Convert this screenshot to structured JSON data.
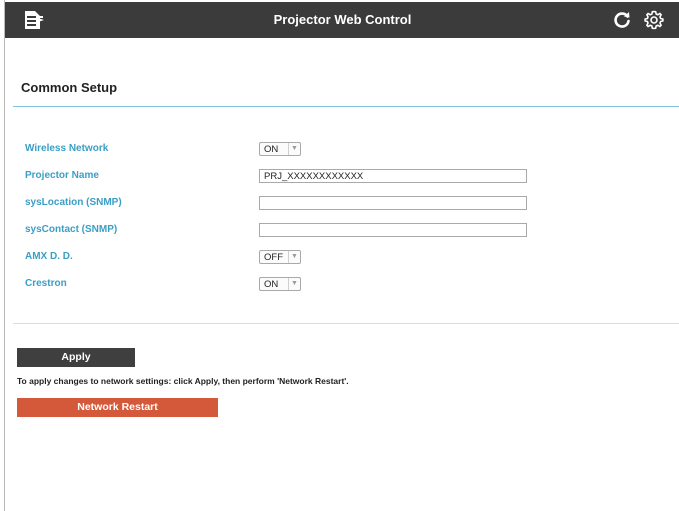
{
  "header": {
    "title": "Projector Web Control",
    "icons": {
      "menu": "menu-icon",
      "refresh": "refresh-icon",
      "settings": "gear-icon"
    },
    "background_color": "#3b3b3b"
  },
  "section": {
    "title": "Common Setup"
  },
  "settings": {
    "wireless_network": {
      "label": "Wireless Network",
      "value": "ON"
    },
    "projector_name": {
      "label": "Projector Name",
      "value": "PRJ_XXXXXXXXXXXX"
    },
    "sys_location": {
      "label": "sysLocation (SNMP)",
      "value": ""
    },
    "sys_contact": {
      "label": "sysContact (SNMP)",
      "value": ""
    },
    "amx_dd": {
      "label": "AMX D. D.",
      "value": "OFF"
    },
    "crestron": {
      "label": "Crestron",
      "value": "ON"
    }
  },
  "actions": {
    "apply_label": "Apply",
    "note": "To apply changes to network settings: click Apply, then perform 'Network Restart'.",
    "restart_label": "Network Restart"
  },
  "colors": {
    "label_color": "#3b9ec5",
    "apply_button": "#3f3f3f",
    "restart_button": "#d4593a",
    "section_rule": "#7fc6d8"
  }
}
